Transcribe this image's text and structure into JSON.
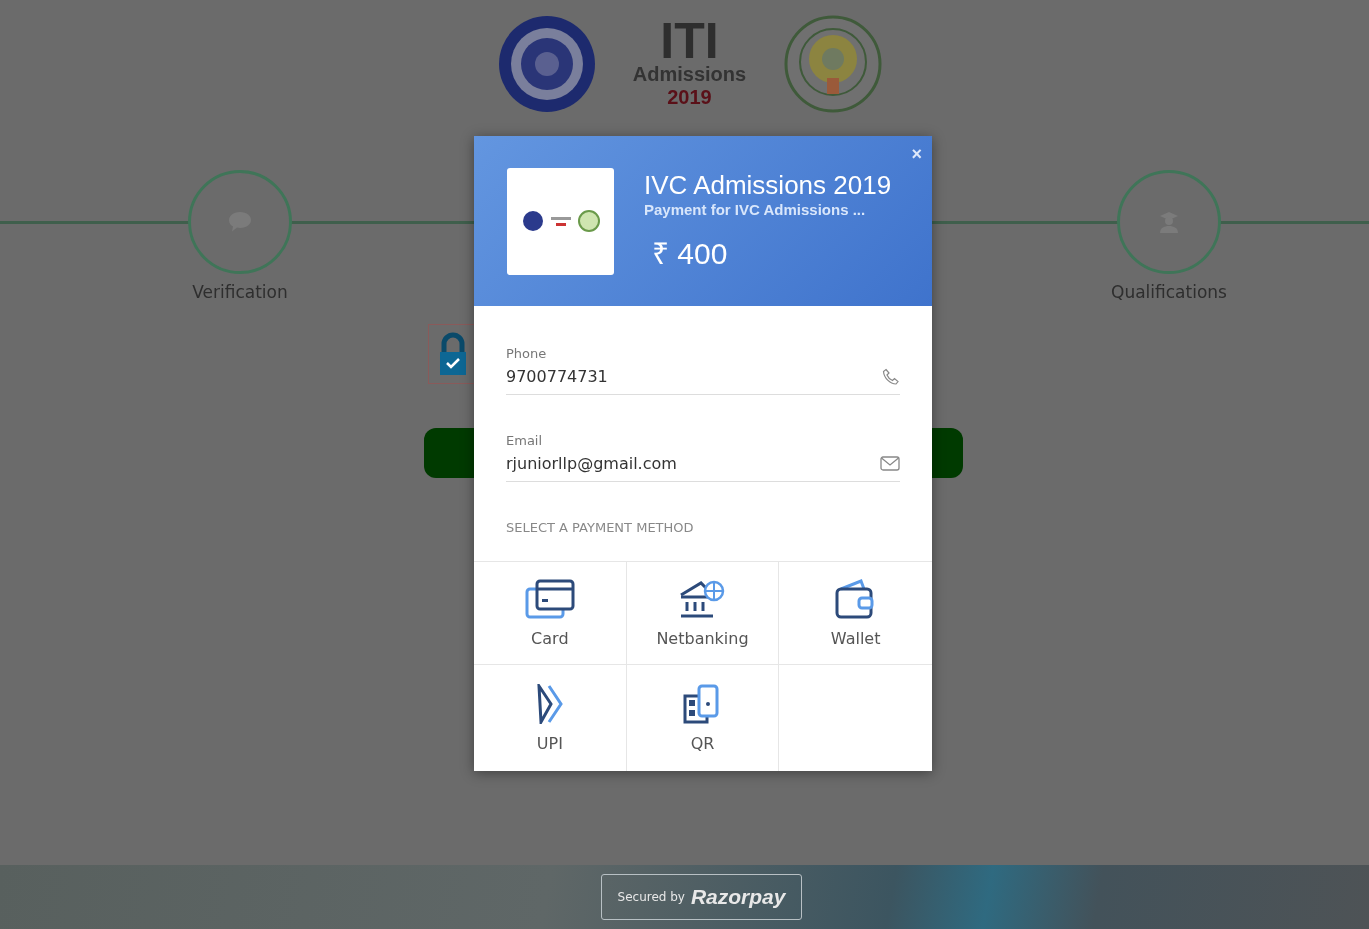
{
  "header": {
    "title": "ITI",
    "subtitle": "Admissions",
    "year": "2019"
  },
  "steps": [
    {
      "label": "Verification",
      "kind": "chat"
    },
    {
      "label": "Qualifications",
      "kind": "graduate"
    }
  ],
  "checkout": {
    "merchant": "IVC Admissions 2019",
    "description": "Payment for IVC Admissions ...",
    "amount": "₹ 400",
    "close": "×",
    "fields": [
      {
        "label": "Phone",
        "value": "9700774731",
        "kind": "phone"
      },
      {
        "label": "Email",
        "value": "rjuniorllp@gmail.com",
        "kind": "email"
      }
    ],
    "section_title": "SELECT A PAYMENT METHOD",
    "methods": [
      {
        "label": "Card",
        "kind": "card"
      },
      {
        "label": "Netbanking",
        "kind": "bank"
      },
      {
        "label": "Wallet",
        "kind": "wallet"
      },
      {
        "label": "UPI",
        "kind": "upi"
      },
      {
        "label": "QR",
        "kind": "qr"
      }
    ]
  },
  "footer": {
    "secured_by": "Secured by",
    "brand": "Razorpay"
  }
}
